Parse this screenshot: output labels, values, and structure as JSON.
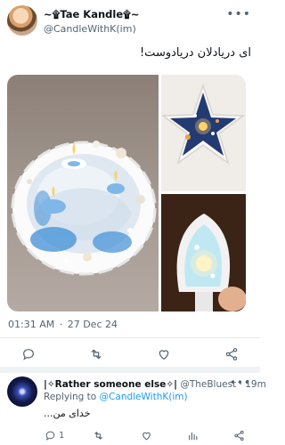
{
  "tweet": {
    "display_name": "~۩Tae Kandle۩~",
    "handle": "@CandleWithK(im)",
    "more_icon": "more-horizontal-icon",
    "text": "ای دریادلان دریادوست!",
    "time": "01:31 AM",
    "date": "27 Dec 24",
    "separator": "·",
    "actions": [
      "reply-icon",
      "retweet-icon",
      "like-icon",
      "share-icon"
    ]
  },
  "reply": {
    "display_name": "|✧Rather someone else✧|",
    "handle": "@TheBluest",
    "separator": "·",
    "time": "19m",
    "replying_label": "Replying to ",
    "replying_to": "@CandleWithK(im)",
    "text": "خدای من...",
    "reply_count": "1",
    "actions": [
      "reply-icon",
      "retweet-icon",
      "like-icon",
      "views-icon",
      "share-icon"
    ]
  },
  "colors": {
    "accent": "#1d9bf0",
    "secondary_text": "#536471",
    "candle_blue": "#3f8fd6"
  }
}
